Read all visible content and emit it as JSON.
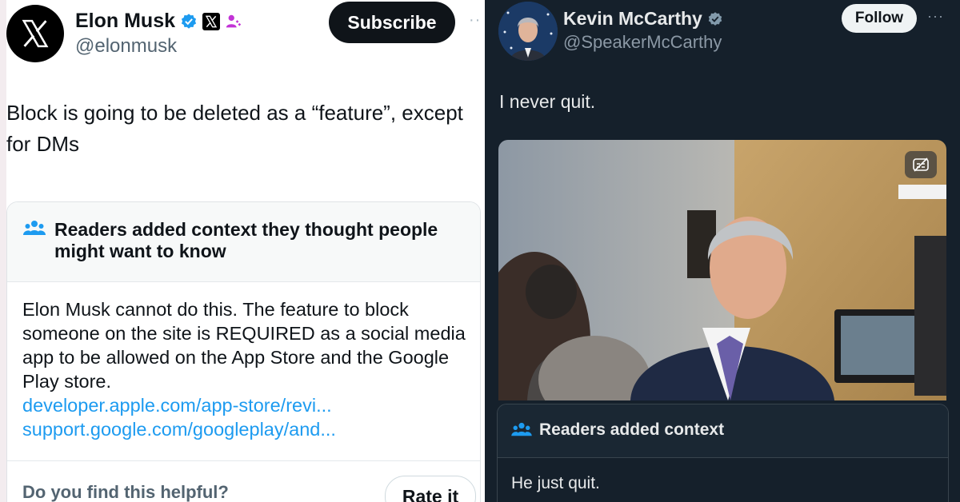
{
  "left_post": {
    "author_name": "Elon Musk",
    "handle": "@elonmusk",
    "subscribe_label": "Subscribe",
    "more_label": "··",
    "text": "Block is going to be deleted as a “feature”, except for DMs",
    "context_title": "Readers added context they thought people might want to know",
    "context_body": "Elon Musk cannot do this. The feature to block someone on the site is REQUIRED as a social media app to be allowed on the App Store and the Google Play store.",
    "context_links": [
      "developer.apple.com/app-store/revi...",
      "support.google.com/googleplay/and..."
    ],
    "helpful_prompt": "Do you find this helpful?",
    "rate_label": "Rate it",
    "icons": [
      "x-logo-icon",
      "verified-badge-icon",
      "x-affiliate-icon",
      "person-badge-icon",
      "readers-group-icon"
    ]
  },
  "right_post": {
    "author_name": "Kevin McCarthy",
    "handle": "@SpeakerMcCarthy",
    "follow_label": "Follow",
    "more_label": "···",
    "text": "I never quit.",
    "context_title": "Readers added context",
    "context_body": "He just quit.",
    "icons": [
      "verified-badge-gray-icon",
      "readers-group-icon",
      "captions-icon"
    ]
  },
  "colors": {
    "accent_blue": "#1d9bf0",
    "dark_bg": "#15202b",
    "light_bg": "#ffffff",
    "badge_purple": "#c233d6",
    "badge_gray": "#829aab"
  }
}
